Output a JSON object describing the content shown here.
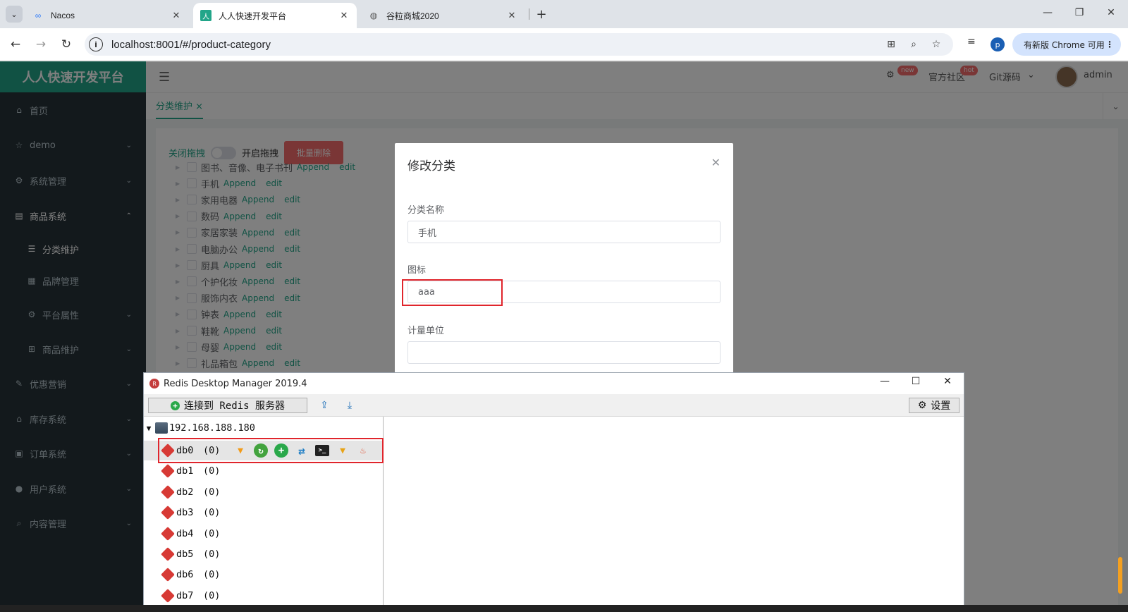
{
  "browser": {
    "tabs": [
      {
        "title": "Nacos",
        "icon": "nacos-infinity-icon"
      },
      {
        "title": "人人快速开发平台",
        "icon": "renren-logo-icon"
      },
      {
        "title": "谷粒商城2020",
        "icon": "globe-icon"
      }
    ],
    "url": "localhost:8001/#/product-category",
    "update_label": "有新版 Chrome 可用",
    "profile_initial": "p"
  },
  "app": {
    "brand": "人人快速开发平台",
    "header": {
      "community": "官方社区",
      "community_badge": "hot",
      "settings_badge": "new",
      "git": "Git源码",
      "user": "admin"
    },
    "page_tab": "分类维护",
    "sidebar": [
      {
        "label": "首页",
        "icon": "home-icon"
      },
      {
        "label": "demo",
        "icon": "star-icon"
      },
      {
        "label": "系统管理",
        "icon": "settings-icon"
      },
      {
        "label": "商品系统",
        "icon": "list-icon"
      },
      {
        "label": "分类维护",
        "icon": "menu-icon"
      },
      {
        "label": "品牌管理",
        "icon": "table-icon"
      },
      {
        "label": "平台属性",
        "icon": "gear-icon"
      },
      {
        "label": "商品维护",
        "icon": "grid-icon"
      },
      {
        "label": "优惠营销",
        "icon": "coupon-icon"
      },
      {
        "label": "库存系统",
        "icon": "house-icon"
      },
      {
        "label": "订单系统",
        "icon": "order-icon"
      },
      {
        "label": "用户系统",
        "icon": "user-icon"
      },
      {
        "label": "内容管理",
        "icon": "search-icon"
      }
    ],
    "drag": {
      "off": "关闭拖拽",
      "on": "开启拖拽",
      "batch_delete": "批量删除"
    },
    "tree": {
      "append": "Append",
      "edit": "edit",
      "items": [
        "图书、音像、电子书刊",
        "手机",
        "家用电器",
        "数码",
        "家居家装",
        "电脑办公",
        "厨具",
        "个护化妆",
        "服饰内衣",
        "钟表",
        "鞋靴",
        "母婴",
        "礼品箱包"
      ]
    }
  },
  "dialog": {
    "title": "修改分类",
    "fields": [
      {
        "label": "分类名称",
        "value": "手机"
      },
      {
        "label": "图标",
        "value": "aaa"
      },
      {
        "label": "计量单位",
        "value": ""
      }
    ]
  },
  "rdm": {
    "title": "Redis Desktop Manager 2019.4",
    "connect": "连接到 Redis 服务器",
    "settings": "设置",
    "server": "192.168.188.180",
    "dbs": [
      {
        "name": "db0",
        "count": "(0)"
      },
      {
        "name": "db1",
        "count": "(0)"
      },
      {
        "name": "db2",
        "count": "(0)"
      },
      {
        "name": "db3",
        "count": "(0)"
      },
      {
        "name": "db4",
        "count": "(0)"
      },
      {
        "name": "db5",
        "count": "(0)"
      },
      {
        "name": "db6",
        "count": "(0)"
      },
      {
        "name": "db7",
        "count": "(0)"
      }
    ]
  },
  "colors": {
    "brand": "#22a589",
    "sidebar": "#263238",
    "danger": "#f56c6c",
    "highlight": "#e0252c"
  }
}
